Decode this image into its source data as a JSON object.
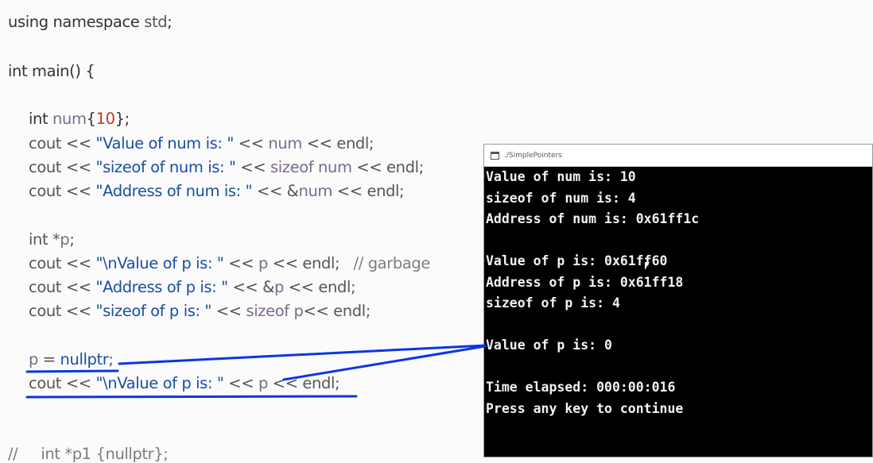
{
  "editor": {
    "lines": [
      {
        "parts": [
          [
            "using namespace ",
            "k"
          ],
          [
            "std",
            "p"
          ],
          [
            ";",
            "k"
          ]
        ]
      },
      {
        "parts": [
          [
            "int main() {",
            "k"
          ]
        ]
      },
      {
        "parts": [
          [
            "int ",
            "k"
          ],
          [
            "num",
            "v"
          ],
          [
            "{",
            "k"
          ],
          [
            "10",
            "n"
          ],
          [
            "};",
            "k"
          ]
        ]
      },
      {
        "parts": [
          [
            "cout",
            "p"
          ],
          [
            " << ",
            "p"
          ],
          [
            "\"Value of num is: \"",
            "s"
          ],
          [
            " << ",
            "p"
          ],
          [
            "num",
            "v"
          ],
          [
            " << endl;",
            "p"
          ]
        ]
      },
      {
        "parts": [
          [
            "cout",
            "p"
          ],
          [
            " << ",
            "p"
          ],
          [
            "\"sizeof of num is: \"",
            "s"
          ],
          [
            " << ",
            "p"
          ],
          [
            "sizeof",
            "v"
          ],
          [
            " num",
            "v"
          ],
          [
            " << endl;",
            "p"
          ]
        ]
      },
      {
        "parts": [
          [
            "cout",
            "p"
          ],
          [
            " << ",
            "p"
          ],
          [
            "\"Address of num is: \"",
            "s"
          ],
          [
            " << &",
            "p"
          ],
          [
            "num",
            "v"
          ],
          [
            " << endl;",
            "p"
          ]
        ]
      },
      {
        "parts": [
          [
            "int *",
            "p"
          ],
          [
            "p",
            "v"
          ],
          [
            ";",
            "p"
          ]
        ]
      },
      {
        "parts": [
          [
            "cout",
            "p"
          ],
          [
            " << ",
            "p"
          ],
          [
            "\"\\nValue of p is: \"",
            "s"
          ],
          [
            " << ",
            "p"
          ],
          [
            "p",
            "v"
          ],
          [
            " << endl;",
            "p"
          ],
          [
            "   // garbage",
            "cm"
          ]
        ]
      },
      {
        "parts": [
          [
            "cout",
            "p"
          ],
          [
            " << ",
            "p"
          ],
          [
            "\"Address of p is: \"",
            "s"
          ],
          [
            " << &",
            "p"
          ],
          [
            "p",
            "v"
          ],
          [
            " << endl;",
            "p"
          ]
        ]
      },
      {
        "parts": [
          [
            "cout",
            "p"
          ],
          [
            " << ",
            "p"
          ],
          [
            "\"sizeof of p is: \"",
            "s"
          ],
          [
            " << ",
            "p"
          ],
          [
            "sizeof",
            "v"
          ],
          [
            " p",
            "v"
          ],
          [
            "<< endl;",
            "p"
          ]
        ]
      },
      {
        "parts": [
          [
            "p",
            "v"
          ],
          [
            " = ",
            "p"
          ],
          [
            "nullptr",
            "s"
          ],
          [
            ";",
            "p"
          ]
        ]
      },
      {
        "parts": [
          [
            "cout",
            "p"
          ],
          [
            " << ",
            "p"
          ],
          [
            "\"\\nValue of p is: \"",
            "s"
          ],
          [
            " << ",
            "p"
          ],
          [
            "p",
            "v"
          ],
          [
            " << endl;",
            "p"
          ]
        ]
      },
      {
        "parts": [
          [
            "//     int *p1 {nullptr};",
            "cm"
          ]
        ]
      }
    ]
  },
  "terminal": {
    "title": "./SimplePointers",
    "lines": [
      "Value of num is: 10",
      "sizeof of num is: 4",
      "Address of num is: 0x61ff1c",
      "",
      "Value of p is: 0x61ff60",
      "Address of p is: 0x61ff18",
      "sizeof of p is: 4",
      "",
      "Value of p is: 0",
      "",
      "Time elapsed: 000:00:016",
      "Press any key to continue"
    ]
  },
  "colors": {
    "annotation": "#0a35e6",
    "terminal_bg": "#000000",
    "string": "#1a4ea3",
    "number": "#c23a1c"
  }
}
